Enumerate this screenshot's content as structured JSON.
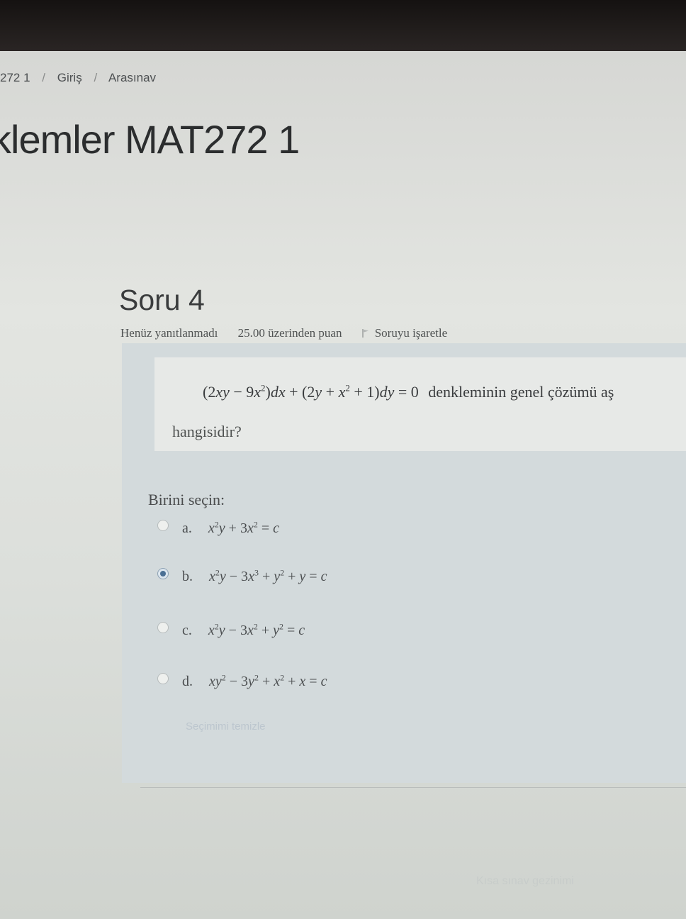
{
  "breadcrumb": {
    "course": "272 1",
    "home": "Giriş",
    "exam": "Arasınav",
    "separator": "/"
  },
  "course_title": "klemler MAT272 1",
  "question": {
    "heading": "Soru 4",
    "status": "Henüz yanıtlanmadı",
    "grade": "25.00 üzerinden puan",
    "flag_label": "Soruyu işaretle",
    "text_tail": "denkleminin genel çözümü aş",
    "text_cont": "hangisidir?"
  },
  "answer": {
    "prompt": "Birini seçin:",
    "options": [
      {
        "letter": "a.",
        "selected": false
      },
      {
        "letter": "b.",
        "selected": true
      },
      {
        "letter": "c.",
        "selected": false
      },
      {
        "letter": "d.",
        "selected": false
      }
    ],
    "clear": "Seçimimi temizle"
  },
  "nav": {
    "next": "Kısa sınav gezinimi"
  },
  "colors": {
    "selected_radio": "#4a6f94",
    "panel": "#d3dadc"
  }
}
